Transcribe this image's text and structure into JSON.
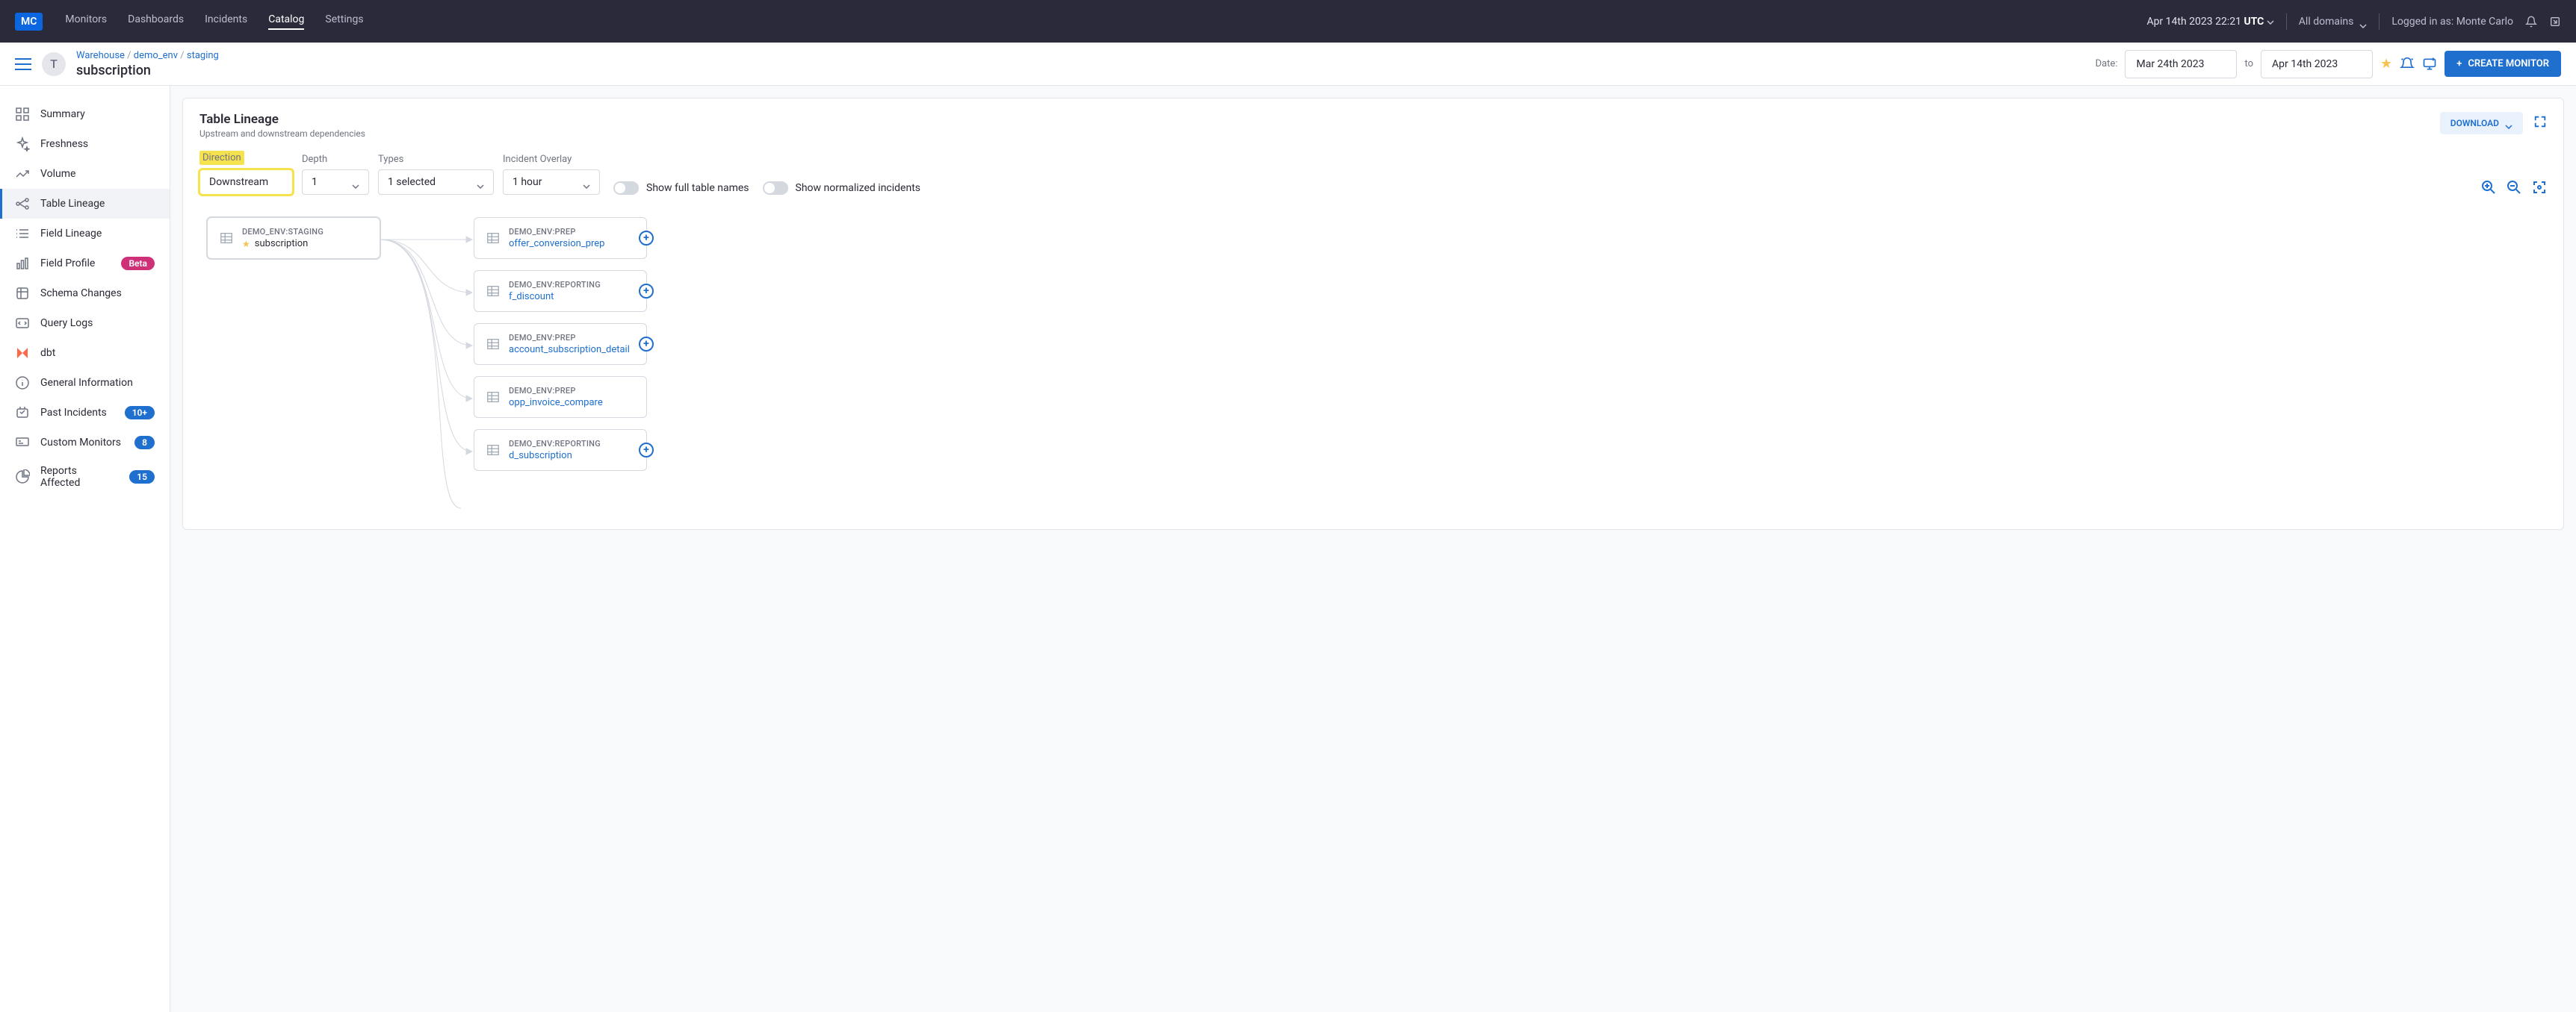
{
  "topbar": {
    "logo": "MC",
    "nav": [
      "Monitors",
      "Dashboards",
      "Incidents",
      "Catalog",
      "Settings"
    ],
    "active_nav": 3,
    "time_prefix": "Apr 14th 2023 22:21 ",
    "time_suffix": "UTC",
    "domain": "All domains",
    "login_text": "Logged in as: Monte Carlo"
  },
  "subhead": {
    "avatar": "T",
    "crumbs": [
      "Warehouse",
      "demo_env",
      "staging"
    ],
    "title": "subscription",
    "date_label": "Date:",
    "date_from": "Mar 24th 2023",
    "date_to_label": "to",
    "date_to": "Apr 14th 2023",
    "create_btn": "CREATE MONITOR"
  },
  "sidebar": [
    {
      "label": "Summary",
      "icon": "grid"
    },
    {
      "label": "Freshness",
      "icon": "sparkles"
    },
    {
      "label": "Volume",
      "icon": "trend"
    },
    {
      "label": "Table Lineage",
      "icon": "lineage"
    },
    {
      "label": "Field Lineage",
      "icon": "list"
    },
    {
      "label": "Field Profile",
      "icon": "bar",
      "badge": "Beta",
      "badge_color": "pink"
    },
    {
      "label": "Schema Changes",
      "icon": "schema"
    },
    {
      "label": "Query Logs",
      "icon": "code"
    },
    {
      "label": "dbt",
      "icon": "dbt"
    },
    {
      "label": "General Information",
      "icon": "info"
    },
    {
      "label": "Past Incidents",
      "icon": "incident",
      "badge": "10+"
    },
    {
      "label": "Custom Monitors",
      "icon": "monitor",
      "badge": "8"
    },
    {
      "label": "Reports Affected",
      "icon": "pie",
      "badge": "15"
    }
  ],
  "active_side": 3,
  "panel": {
    "title": "Table Lineage",
    "subtitle": "Upstream and downstream dependencies",
    "download": "DOWNLOAD"
  },
  "filters": {
    "direction_label": "Direction",
    "direction_value": "Downstream",
    "depth_label": "Depth",
    "depth_value": "1",
    "types_label": "Types",
    "types_value": "1 selected",
    "overlay_label": "Incident Overlay",
    "overlay_value": "1 hour",
    "toggle1": "Show full table names",
    "toggle2": "Show normalized incidents"
  },
  "graph": {
    "root": {
      "db": "DEMO_ENV:STAGING",
      "name": "subscription"
    },
    "children": [
      {
        "db": "DEMO_ENV:PREP",
        "name": "offer_conversion_prep",
        "plus": true
      },
      {
        "db": "DEMO_ENV:REPORTING",
        "name": "f_discount",
        "plus": true
      },
      {
        "db": "DEMO_ENV:PREP",
        "name": "account_subscription_detail",
        "plus": true
      },
      {
        "db": "DEMO_ENV:PREP",
        "name": "opp_invoice_compare",
        "plus": false
      },
      {
        "db": "DEMO_ENV:REPORTING",
        "name": "d_subscription",
        "plus": true
      }
    ]
  }
}
